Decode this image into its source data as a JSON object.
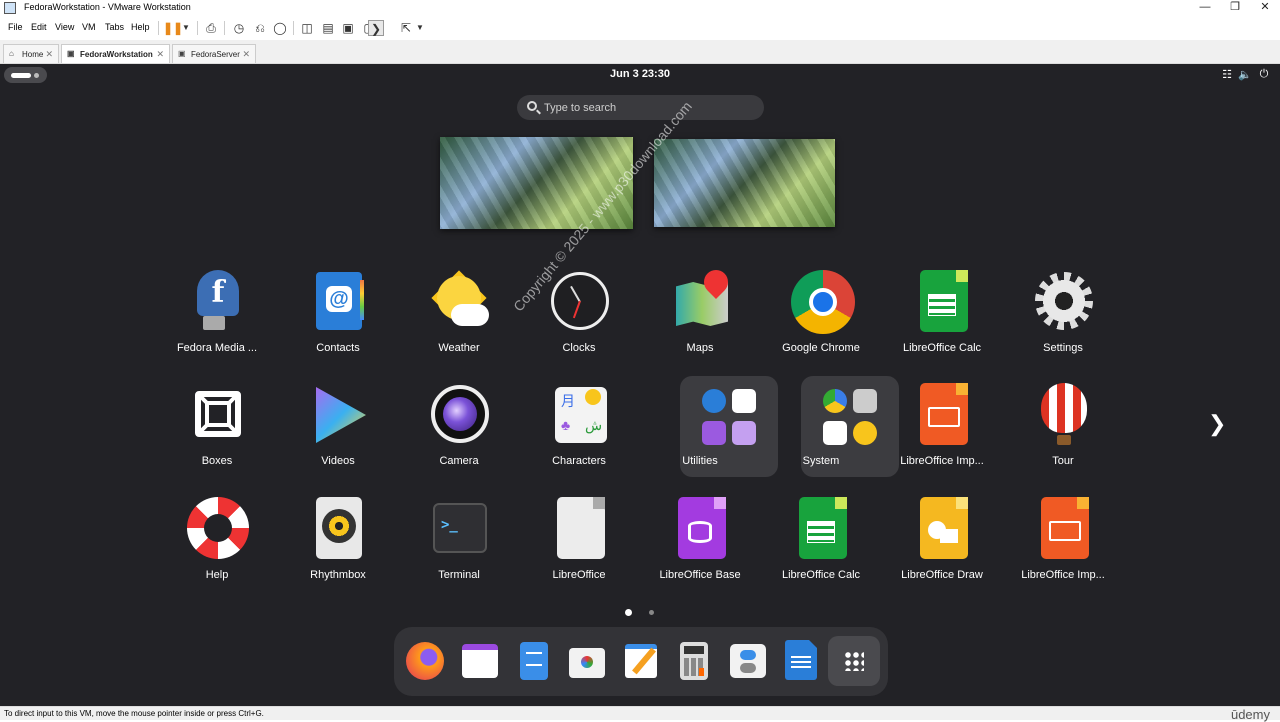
{
  "window": {
    "title": "FedoraWorkstation - VMware Workstation"
  },
  "menu": [
    "File",
    "Edit",
    "View",
    "VM",
    "Tabs",
    "Help"
  ],
  "tabs": [
    {
      "label": "Home",
      "active": false
    },
    {
      "label": "FedoraWorkstation",
      "active": true
    },
    {
      "label": "FedoraServer",
      "active": false
    }
  ],
  "gnome": {
    "clock": "Jun 3  23:30",
    "search_placeholder": "Type to search",
    "watermark": "Copyright © 2025 - www.p30download.com",
    "apps": [
      {
        "label": "Fedora Media ...",
        "icon": "fedora-media-writer-icon"
      },
      {
        "label": "Contacts",
        "icon": "contacts-icon"
      },
      {
        "label": "Weather",
        "icon": "weather-icon"
      },
      {
        "label": "Clocks",
        "icon": "clocks-icon"
      },
      {
        "label": "Maps",
        "icon": "maps-icon"
      },
      {
        "label": "Google Chrome",
        "icon": "chrome-icon"
      },
      {
        "label": "LibreOffice Calc",
        "icon": "libreoffice-calc-icon"
      },
      {
        "label": "Settings",
        "icon": "settings-gear-icon"
      },
      {
        "label": "Boxes",
        "icon": "boxes-icon"
      },
      {
        "label": "Videos",
        "icon": "videos-icon"
      },
      {
        "label": "Camera",
        "icon": "camera-icon"
      },
      {
        "label": "Characters",
        "icon": "characters-icon"
      },
      {
        "label": "Utilities",
        "icon": "utilities-folder-icon"
      },
      {
        "label": "System",
        "icon": "system-folder-icon"
      },
      {
        "label": "LibreOffice Imp...",
        "icon": "libreoffice-impress-icon"
      },
      {
        "label": "Tour",
        "icon": "tour-balloon-icon"
      },
      {
        "label": "Help",
        "icon": "help-lifebuoy-icon"
      },
      {
        "label": "Rhythmbox",
        "icon": "rhythmbox-icon"
      },
      {
        "label": "Terminal",
        "icon": "terminal-icon"
      },
      {
        "label": "LibreOffice",
        "icon": "libreoffice-icon"
      },
      {
        "label": "LibreOffice Base",
        "icon": "libreoffice-base-icon"
      },
      {
        "label": "LibreOffice Calc",
        "icon": "libreoffice-calc-icon"
      },
      {
        "label": "LibreOffice Draw",
        "icon": "libreoffice-draw-icon"
      },
      {
        "label": "LibreOffice Imp...",
        "icon": "libreoffice-impress-icon"
      }
    ],
    "page_count": 2,
    "current_page": 1,
    "dash": [
      "firefox-icon",
      "calendar-icon",
      "files-icon",
      "software-icon",
      "text-editor-icon",
      "calculator-icon",
      "toggle-settings-icon",
      "libreoffice-writer-icon",
      "show-apps-grid-icon"
    ]
  },
  "statusbar": {
    "text": "To direct input to this VM, move the mouse pointer inside or press Ctrl+G.",
    "brand": "ūdemy"
  }
}
